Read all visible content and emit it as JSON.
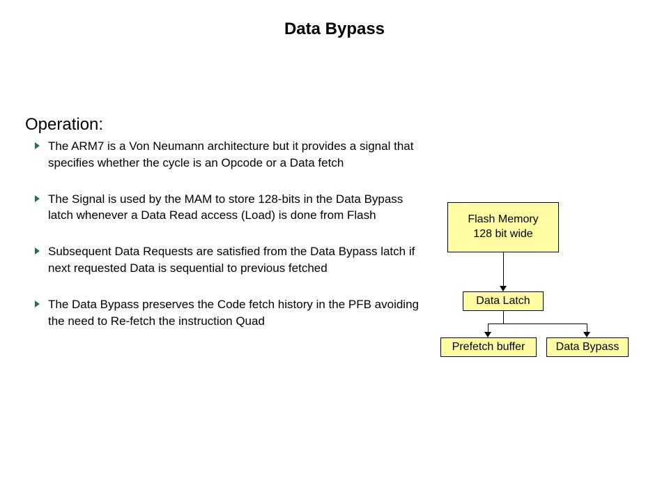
{
  "title": "Data Bypass",
  "section_heading": "Operation:",
  "bullets": [
    "The ARM7 is a Von Neumann architecture but it provides a signal that specifies whether the cycle is an Opcode or a Data fetch",
    "The Signal is used by the MAM to store 128-bits in the Data Bypass latch whenever a Data Read access (Load) is done from Flash",
    "Subsequent Data Requests are satisfied from the Data Bypass latch if next requested Data is sequential to previous fetched",
    "The Data Bypass preserves the Code fetch history in the PFB avoiding the need to Re-fetch the instruction Quad"
  ],
  "diagram": {
    "flash_line1": "Flash Memory",
    "flash_line2": "128 bit wide",
    "latch": "Data Latch",
    "prefetch": "Prefetch buffer",
    "bypass": "Data Bypass"
  }
}
